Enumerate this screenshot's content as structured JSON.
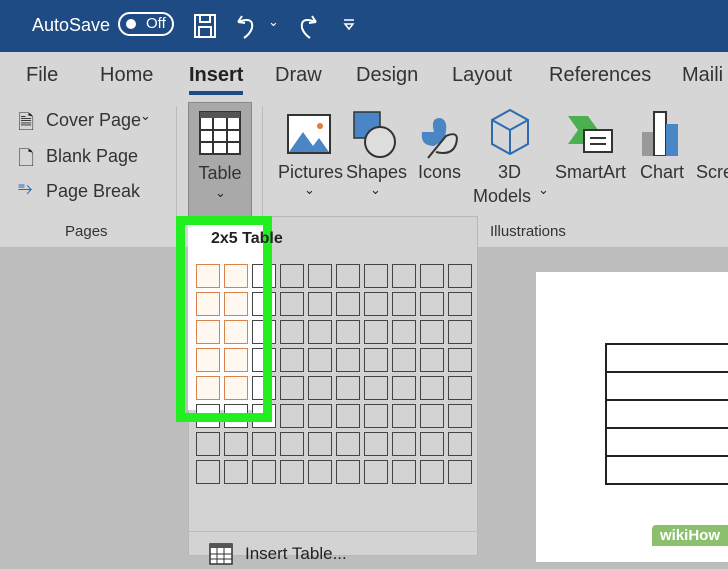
{
  "titlebar": {
    "autosave_label": "AutoSave",
    "autosave_state": "Off"
  },
  "tabs": [
    "File",
    "Home",
    "Insert",
    "Draw",
    "Design",
    "Layout",
    "References",
    "Maili"
  ],
  "active_tab": "Insert",
  "pages_group": {
    "items": [
      "Cover Page",
      "Blank Page",
      "Page Break"
    ],
    "label": "Pages"
  },
  "table_button": {
    "label": "Table"
  },
  "illustrations": {
    "items": [
      "Pictures",
      "Shapes",
      "Icons",
      "3D",
      "SmartArt",
      "Chart",
      "Scre"
    ],
    "models_label": "Models",
    "label": "Illustrations"
  },
  "table_menu": {
    "header": "2x5 Table",
    "columns": 10,
    "rows": 8,
    "selected_columns": 2,
    "selected_rows": 5,
    "insert_table_label": "Insert Table..."
  },
  "colors": {
    "accent": "#1f4b85",
    "highlight": "#22ee22",
    "selection": "#d8824a"
  },
  "watermark": "wikiHow"
}
